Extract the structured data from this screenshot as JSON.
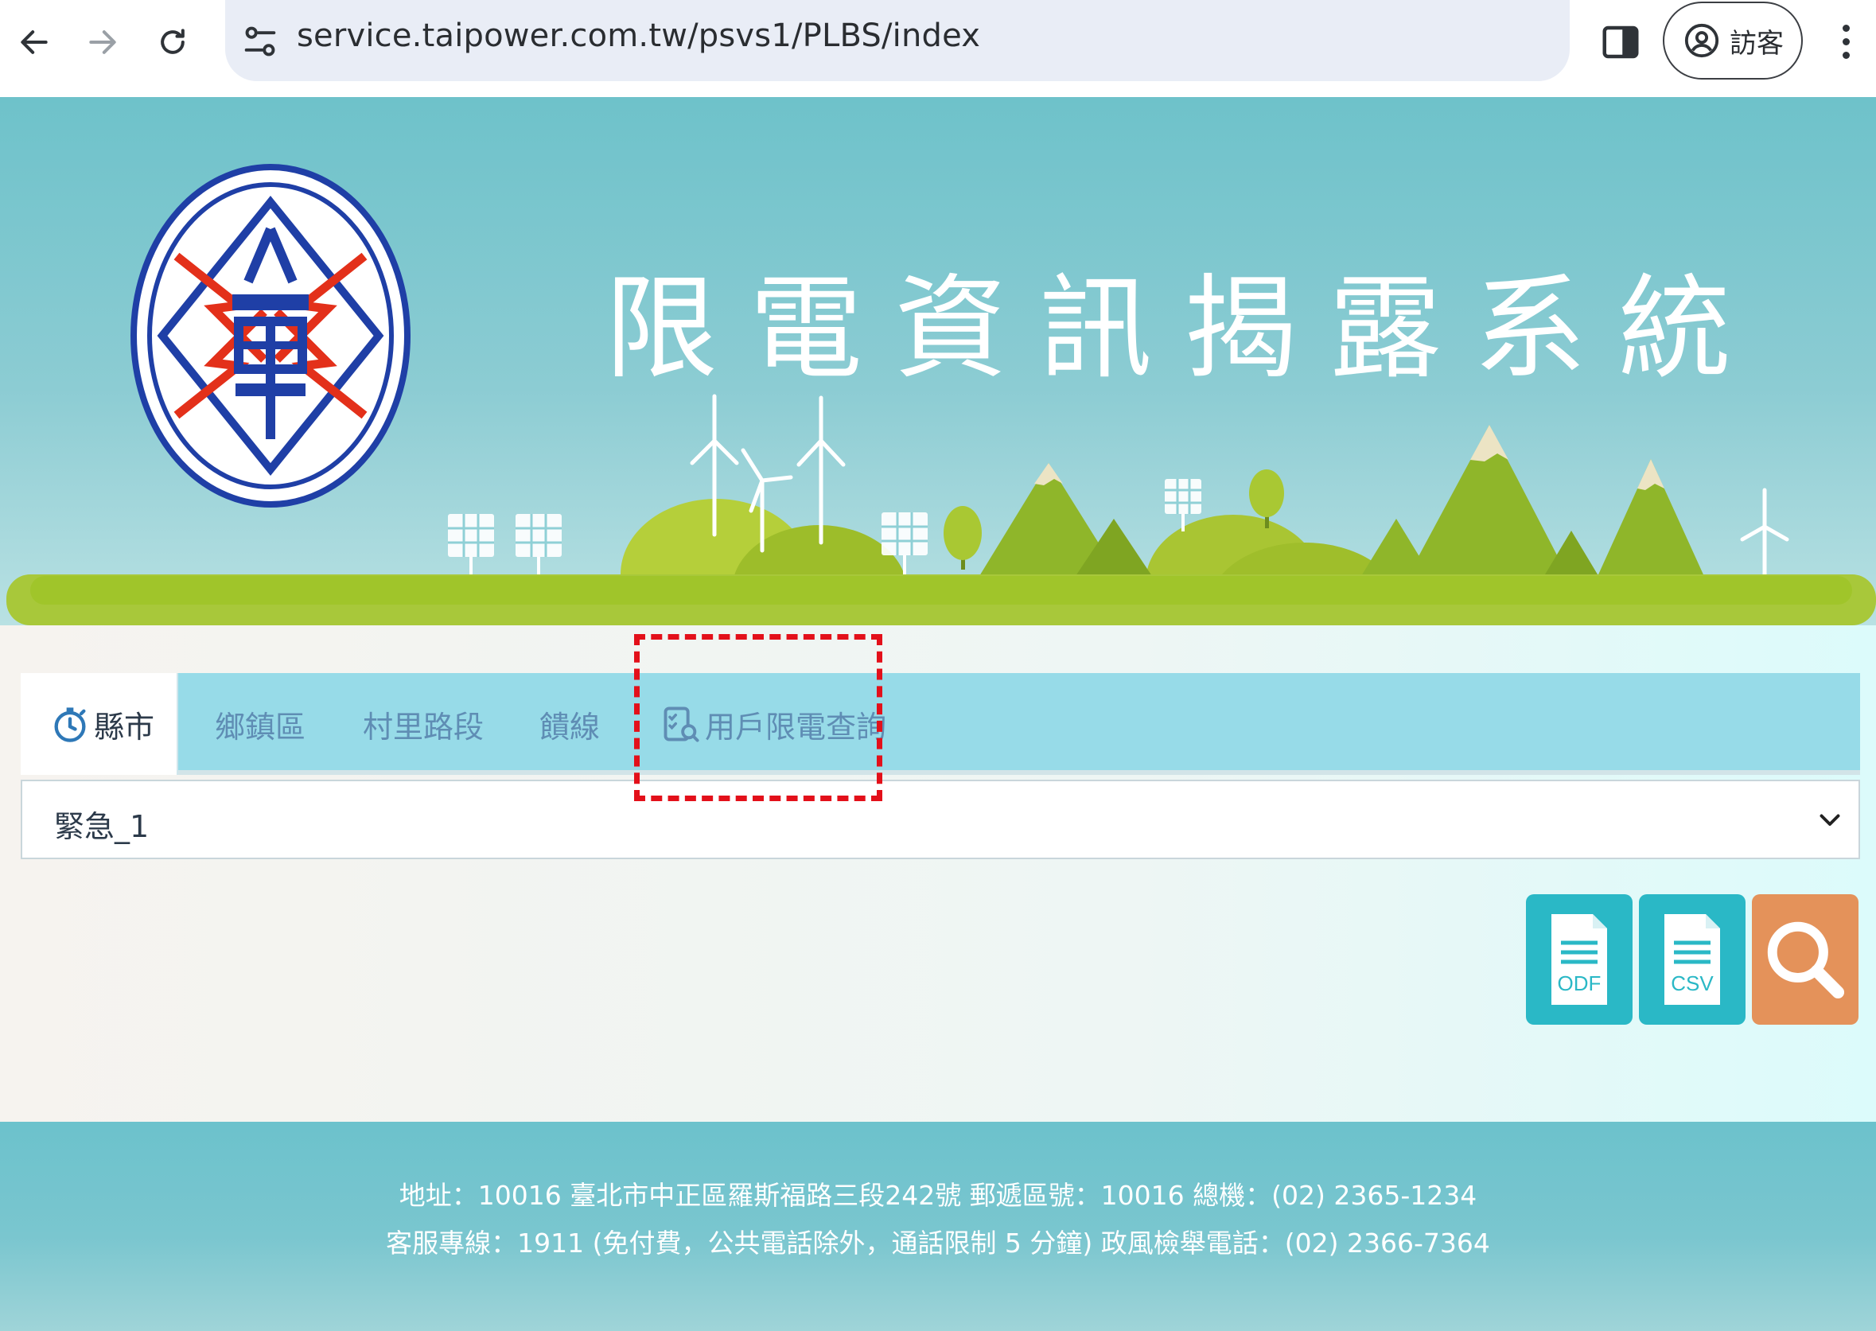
{
  "browser": {
    "url": "service.taipower.com.tw/psvs1/PLBS/index",
    "profile_label": "訪客"
  },
  "header": {
    "title": "限電資訊揭露系統"
  },
  "tabs": [
    {
      "label": "縣市",
      "icon": "stopwatch-icon",
      "active": true
    },
    {
      "label": "鄉鎮區",
      "active": false
    },
    {
      "label": "村里路段",
      "active": false
    },
    {
      "label": "饋線",
      "active": false
    },
    {
      "label": "用戶限電查詢",
      "icon": "checklist-search-icon",
      "active": false
    }
  ],
  "select": {
    "value": "緊急_1"
  },
  "actions": {
    "odf_label": "ODF",
    "csv_label": "CSV"
  },
  "footer": {
    "line1": "地址：10016 臺北市中正區羅斯福路三段242號 郵遞區號：10016 總機：(02) 2365-1234",
    "line2": "客服專線：1911 (免付費，公共電話除外，通話限制 5 分鐘) 政風檢舉電話：(02) 2366-7364"
  },
  "colors": {
    "tab_bar": "#97dbe8",
    "teal_button": "#2ab8c6",
    "orange_button": "#e4925a",
    "highlight": "#e3101a"
  }
}
